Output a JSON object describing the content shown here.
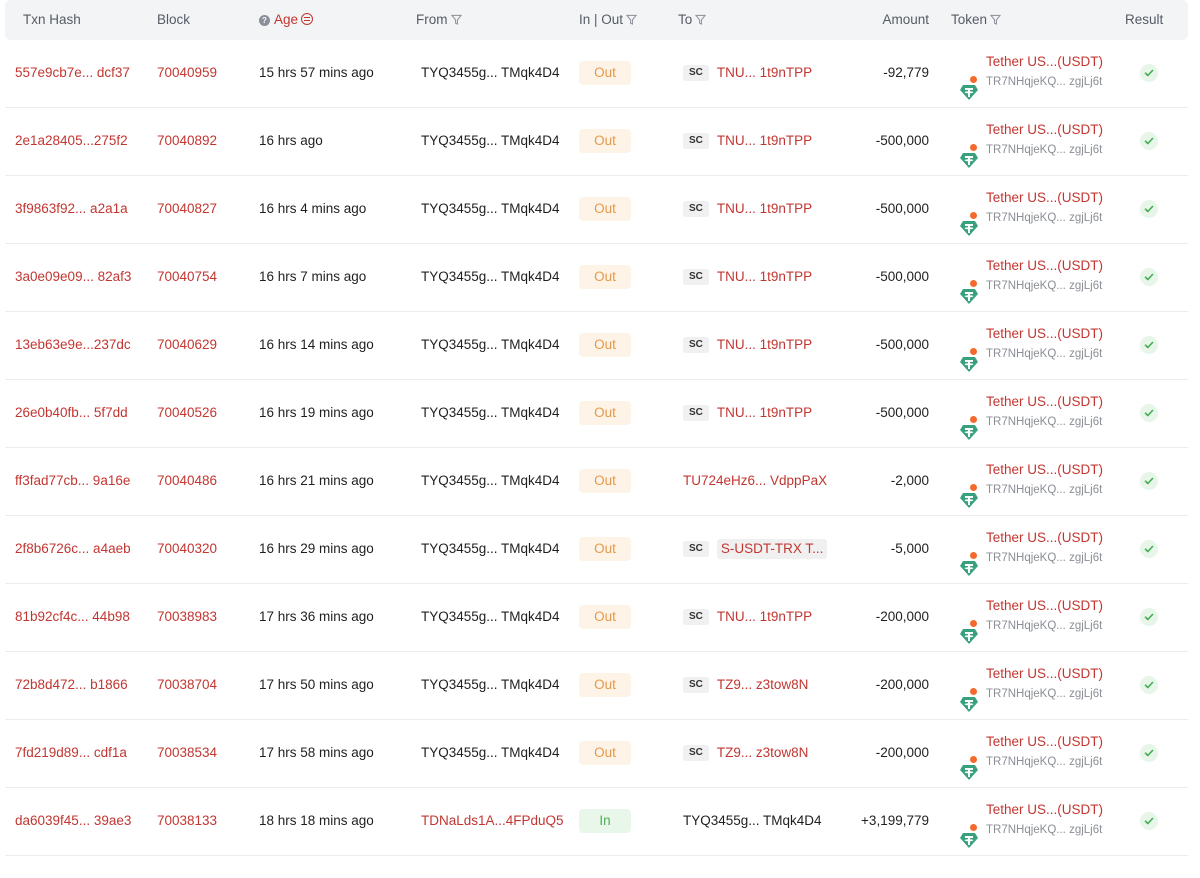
{
  "columns": {
    "txn_hash": "Txn Hash",
    "block": "Block",
    "age": "Age",
    "from": "From",
    "in_out": "In | Out",
    "to": "To",
    "amount": "Amount",
    "token": "Token",
    "result": "Result"
  },
  "colors": {
    "link": "#c23631",
    "out_badge": "#e39a4b",
    "in_badge": "#4caf50",
    "token_green": "#3aa17e"
  },
  "rows": [
    {
      "hash": "557e9cb7e... dcf37",
      "block": "70040959",
      "age": "15 hrs 57 mins ago",
      "from": "TYQ3455g... TMqk4D4",
      "dir": "Out",
      "to_sc": "SC",
      "to": "TNU... 1t9nTPP",
      "amount": "-92,779",
      "token_name": "Tether US...(USDT)",
      "token_addr": "TR7NHqjeKQ... zgjLj6t",
      "result_icon": "check-icon"
    },
    {
      "hash": "2e1a28405...275f2",
      "block": "70040892",
      "age": "16 hrs ago",
      "from": "TYQ3455g... TMqk4D4",
      "dir": "Out",
      "to_sc": "SC",
      "to": "TNU... 1t9nTPP",
      "amount": "-500,000",
      "token_name": "Tether US...(USDT)",
      "token_addr": "TR7NHqjeKQ... zgjLj6t",
      "result_icon": "check-icon"
    },
    {
      "hash": "3f9863f92... a2a1a",
      "block": "70040827",
      "age": "16 hrs 4 mins ago",
      "from": "TYQ3455g... TMqk4D4",
      "dir": "Out",
      "to_sc": "SC",
      "to": "TNU... 1t9nTPP",
      "amount": "-500,000",
      "token_name": "Tether US...(USDT)",
      "token_addr": "TR7NHqjeKQ... zgjLj6t",
      "result_icon": "check-icon"
    },
    {
      "hash": "3a0e09e09... 82af3",
      "block": "70040754",
      "age": "16 hrs 7 mins ago",
      "from": "TYQ3455g... TMqk4D4",
      "dir": "Out",
      "to_sc": "SC",
      "to": "TNU... 1t9nTPP",
      "amount": "-500,000",
      "token_name": "Tether US...(USDT)",
      "token_addr": "TR7NHqjeKQ... zgjLj6t",
      "result_icon": "check-icon"
    },
    {
      "hash": "13eb63e9e...237dc",
      "block": "70040629",
      "age": "16 hrs 14 mins ago",
      "from": "TYQ3455g... TMqk4D4",
      "dir": "Out",
      "to_sc": "SC",
      "to": "TNU... 1t9nTPP",
      "amount": "-500,000",
      "token_name": "Tether US...(USDT)",
      "token_addr": "TR7NHqjeKQ... zgjLj6t",
      "result_icon": "check-icon"
    },
    {
      "hash": "26e0b40fb... 5f7dd",
      "block": "70040526",
      "age": "16 hrs 19 mins ago",
      "from": "TYQ3455g... TMqk4D4",
      "dir": "Out",
      "to_sc": "SC",
      "to": "TNU... 1t9nTPP",
      "amount": "-500,000",
      "token_name": "Tether US...(USDT)",
      "token_addr": "TR7NHqjeKQ... zgjLj6t",
      "result_icon": "check-icon"
    },
    {
      "hash": "ff3fad77cb... 9a16e",
      "block": "70040486",
      "age": "16 hrs 21 mins ago",
      "from": "TYQ3455g... TMqk4D4",
      "dir": "Out",
      "to_sc": "",
      "to": "TU724eHz6... VdppPaX",
      "amount": "-2,000",
      "token_name": "Tether US...(USDT)",
      "token_addr": "TR7NHqjeKQ... zgjLj6t",
      "result_icon": "check-icon"
    },
    {
      "hash": "2f8b6726c... a4aeb",
      "block": "70040320",
      "age": "16 hrs 29 mins ago",
      "from": "TYQ3455g... TMqk4D4",
      "dir": "Out",
      "to_sc": "SC",
      "to": "S-USDT-TRX T...",
      "to_boxed": true,
      "amount": "-5,000",
      "token_name": "Tether US...(USDT)",
      "token_addr": "TR7NHqjeKQ... zgjLj6t",
      "result_icon": "check-icon"
    },
    {
      "hash": "81b92cf4c... 44b98",
      "block": "70038983",
      "age": "17 hrs 36 mins ago",
      "from": "TYQ3455g... TMqk4D4",
      "dir": "Out",
      "to_sc": "SC",
      "to": "TNU... 1t9nTPP",
      "amount": "-200,000",
      "token_name": "Tether US...(USDT)",
      "token_addr": "TR7NHqjeKQ... zgjLj6t",
      "result_icon": "check-icon"
    },
    {
      "hash": "72b8d472... b1866",
      "block": "70038704",
      "age": "17 hrs 50 mins ago",
      "from": "TYQ3455g... TMqk4D4",
      "dir": "Out",
      "to_sc": "SC",
      "to": "TZ9... z3tow8N",
      "amount": "-200,000",
      "token_name": "Tether US...(USDT)",
      "token_addr": "TR7NHqjeKQ... zgjLj6t",
      "result_icon": "check-icon"
    },
    {
      "hash": "7fd219d89... cdf1a",
      "block": "70038534",
      "age": "17 hrs 58 mins ago",
      "from": "TYQ3455g... TMqk4D4",
      "dir": "Out",
      "to_sc": "SC",
      "to": "TZ9... z3tow8N",
      "amount": "-200,000",
      "token_name": "Tether US...(USDT)",
      "token_addr": "TR7NHqjeKQ... zgjLj6t",
      "result_icon": "check-icon"
    },
    {
      "hash": "da6039f45... 39ae3",
      "block": "70038133",
      "age": "18 hrs 18 mins ago",
      "from": "TDNaLds1A...4FPduQ5",
      "from_link": true,
      "dir": "In",
      "to_sc": "",
      "to": "TYQ3455g... TMqk4D4",
      "to_dark": true,
      "amount": "+3,199,779",
      "token_name": "Tether US...(USDT)",
      "token_addr": "TR7NHqjeKQ... zgjLj6t",
      "result_icon": "check-icon"
    }
  ]
}
